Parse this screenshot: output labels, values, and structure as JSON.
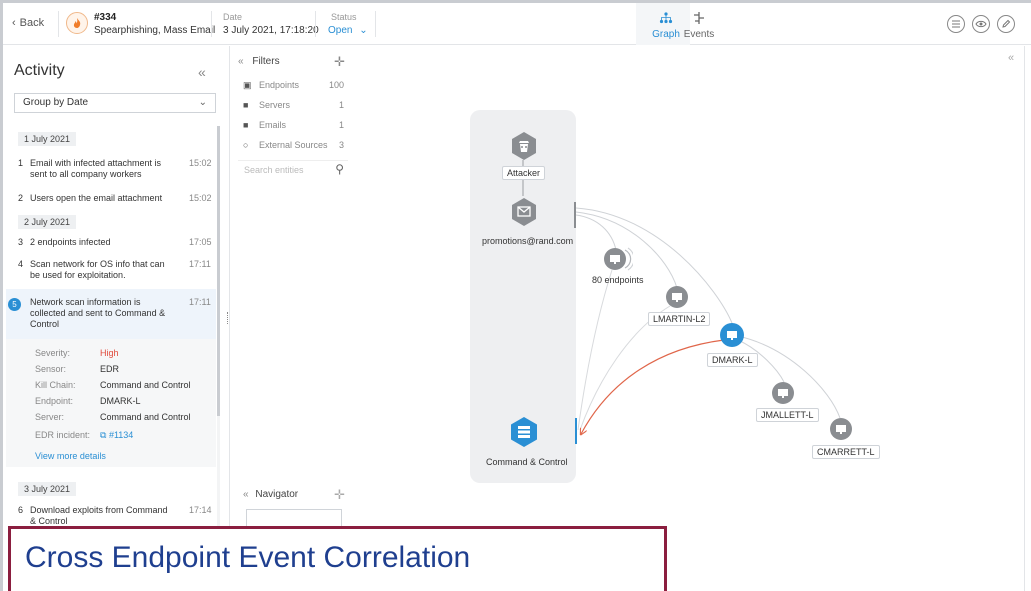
{
  "header": {
    "back_label": "Back",
    "incident_id": "#334",
    "incident_title": "Spearphishing, Mass Email",
    "date_label": "Date",
    "date_value": "3 July 2021, 17:18:20",
    "status_label": "Status",
    "status_value": "Open",
    "tabs": [
      {
        "label": "Graph",
        "active": true
      },
      {
        "label": "Events",
        "active": false
      }
    ]
  },
  "activity": {
    "title": "Activity",
    "group_by": "Group by Date",
    "dates": [
      "1 July 2021",
      "2 July 2021",
      "3 July 2021"
    ],
    "events": [
      {
        "num": "1",
        "text": "Email with infected attachment is sent to all company workers",
        "time": "15:02"
      },
      {
        "num": "2",
        "text": "Users open the email attachment",
        "time": "15:02"
      },
      {
        "num": "3",
        "text": "2 endpoints infected",
        "time": "17:05"
      },
      {
        "num": "4",
        "text": "Scan network for OS info that can be used for exploitation.",
        "time": "17:11"
      },
      {
        "num": "5",
        "text": "Network scan information is collected and sent to Command & Control",
        "time": "17:11"
      },
      {
        "num": "6",
        "text": "Download exploits from Command & Control",
        "time": "17:14"
      }
    ],
    "details": [
      {
        "key": "Severity:",
        "value": "High"
      },
      {
        "key": "Sensor:",
        "value": "EDR"
      },
      {
        "key": "Kill Chain:",
        "value": "Command and Control"
      },
      {
        "key": "Endpoint:",
        "value": "DMARK-L"
      },
      {
        "key": "Server:",
        "value": "Command and Control"
      },
      {
        "key": "EDR incident:",
        "value": "#1134"
      }
    ],
    "view_more": "View more details"
  },
  "filters": {
    "title": "Filters",
    "rows": [
      {
        "label": "Endpoints",
        "count": "100"
      },
      {
        "label": "Servers",
        "count": "1"
      },
      {
        "label": "Emails",
        "count": "1"
      },
      {
        "label": "External Sources",
        "count": "3"
      }
    ],
    "search_placeholder": "Search entities"
  },
  "graph": {
    "nodes": [
      {
        "label": "Attacker",
        "kind": "attacker"
      },
      {
        "label": "promotions@rand.com",
        "kind": "email"
      },
      {
        "label": "80 endpoints",
        "kind": "endpoint-group"
      },
      {
        "label": "LMARTIN-L2",
        "kind": "endpoint"
      },
      {
        "label": "DMARK-L",
        "kind": "endpoint-highlighted"
      },
      {
        "label": "JMALLETT-L",
        "kind": "endpoint"
      },
      {
        "label": "CMARRETT-L",
        "kind": "endpoint"
      },
      {
        "label": "Command & Control",
        "kind": "server"
      }
    ],
    "colors": {
      "highlight": "#2a8fd4",
      "attack_edge": "#e0664a",
      "node": "#8a8d91",
      "edge": "#cfd2d6"
    }
  },
  "navigator": {
    "title": "Navigator"
  },
  "caption": "Cross Endpoint Event Correlation"
}
